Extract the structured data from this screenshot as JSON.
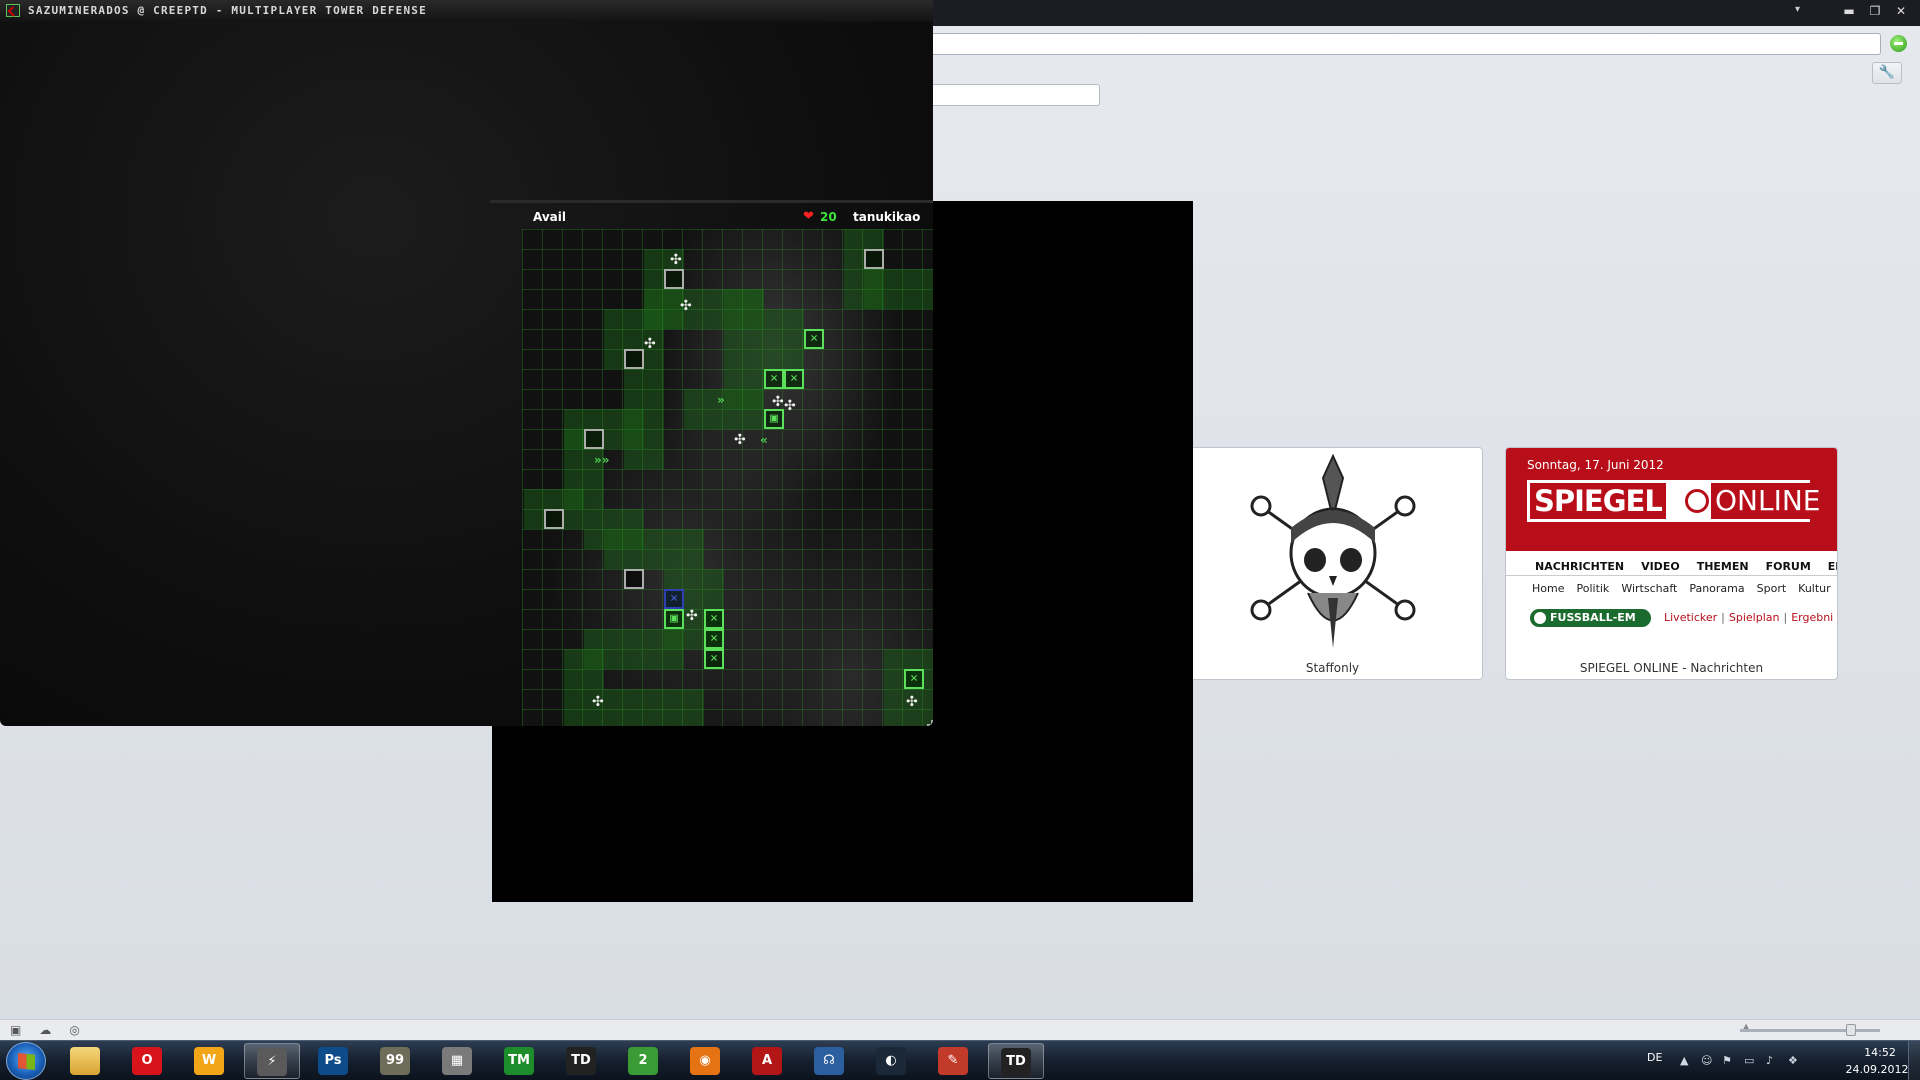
{
  "game_window": {
    "title": "SAZUMINERADOS @ CREEPTD - MULTIPLAYER TOWER DEFENSE",
    "hud": {
      "avail_label": "Avail",
      "lives": "20",
      "player": "tanukikao"
    }
  },
  "browser": {
    "address_value": "",
    "search_value": "",
    "speed_dial": [
      {
        "caption": "Staffonly"
      },
      {
        "caption": "SPIEGEL ONLINE - Nachrichten",
        "date": "Sonntag, 17. Juni 2012",
        "logo_left": "SPIEGEL",
        "logo_right": "ONLINE",
        "nav": [
          "NACHRICHTEN",
          "VIDEO",
          "THEMEN",
          "FORUM",
          "EN"
        ],
        "subnav": [
          "Home",
          "Politik",
          "Wirtschaft",
          "Panorama",
          "Sport",
          "Kultur"
        ],
        "em_badge": "FUSSBALL-EM",
        "em_links": [
          "Liveticker",
          "Spielplan",
          "Ergebni"
        ]
      }
    ]
  },
  "taskbar": {
    "apps": [
      {
        "name": "explorer",
        "label": ""
      },
      {
        "name": "opera",
        "label": "O",
        "color": "#d8141a"
      },
      {
        "name": "winamp",
        "label": "W",
        "color": "#f2a516"
      },
      {
        "name": "app-lightning",
        "label": "⚡",
        "color": "#5a5a5a"
      },
      {
        "name": "photoshop",
        "label": "Ps",
        "color": "#0d4b8a"
      },
      {
        "name": "notes",
        "label": "99",
        "color": "#6d6d5a"
      },
      {
        "name": "calculator",
        "label": "▦",
        "color": "#7a7a7a"
      },
      {
        "name": "tm",
        "label": "TM",
        "color": "#1d8c2a"
      },
      {
        "name": "creeptd",
        "label": "TD",
        "color": "#222222"
      },
      {
        "name": "app-2",
        "label": "2",
        "color": "#3a9a35"
      },
      {
        "name": "blender",
        "label": "◉",
        "color": "#e57314"
      },
      {
        "name": "app-a",
        "label": "A",
        "color": "#b21616"
      },
      {
        "name": "teamspeak",
        "label": "☊",
        "color": "#2b5f9e"
      },
      {
        "name": "steam",
        "label": "◐",
        "color": "#1b2838"
      },
      {
        "name": "notepad",
        "label": "✎",
        "color": "#c23a2a"
      },
      {
        "name": "creeptd-active",
        "label": "TD",
        "color": "#222222"
      }
    ],
    "tray": {
      "lang": "DE",
      "time": "14:52",
      "date": "24.09.2012"
    }
  },
  "colors": {
    "path_green": "#1c5a18",
    "grid_green": "#289628",
    "tower_green": "#5ce05c",
    "spiegel_red": "#b80e19"
  }
}
